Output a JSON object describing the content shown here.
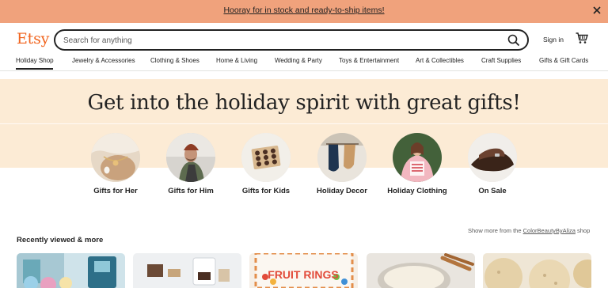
{
  "promo": {
    "text": "Hooray for in stock and ready-to-ship items!"
  },
  "header": {
    "logo": "Etsy",
    "search_placeholder": "Search for anything",
    "signin": "Sign in"
  },
  "nav": {
    "items": [
      {
        "label": "Holiday Shop"
      },
      {
        "label": "Jewelry & Accessories"
      },
      {
        "label": "Clothing & Shoes"
      },
      {
        "label": "Home & Living"
      },
      {
        "label": "Wedding & Party"
      },
      {
        "label": "Toys & Entertainment"
      },
      {
        "label": "Art & Collectibles"
      },
      {
        "label": "Craft Supplies"
      },
      {
        "label": "Gifts & Gift Cards"
      }
    ],
    "active": "Holiday Shop"
  },
  "hero": {
    "title": "Get into the holiday spirit with great gifts!",
    "categories": [
      {
        "label": "Gifts for Her"
      },
      {
        "label": "Gifts for Him"
      },
      {
        "label": "Gifts for Kids"
      },
      {
        "label": "Holiday Decor"
      },
      {
        "label": "Holiday Clothing"
      },
      {
        "label": "On Sale"
      }
    ]
  },
  "recent": {
    "title": "Recently viewed & more",
    "shop_more_prefix": "Show more from the",
    "shop_name": "ColorBeautyByAliza",
    "shop_more_suffix": "shop",
    "card_4_text": "FRUIT RINGS"
  },
  "colors": {
    "promo_bg": "#f0a27c",
    "brand": "#f1641e",
    "hero_bg": "#fcebd5"
  }
}
